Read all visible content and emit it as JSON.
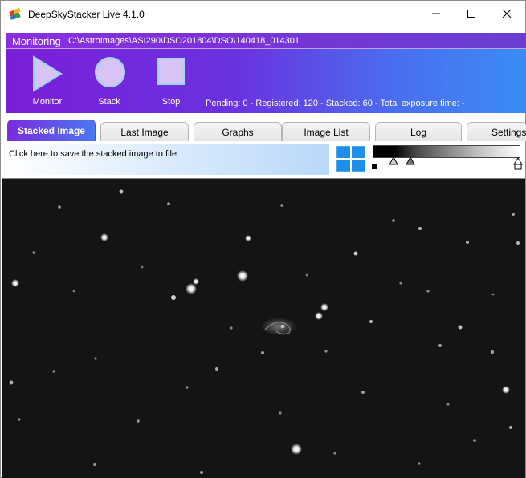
{
  "window": {
    "title": "DeepSkyStacker Live 4.1.0",
    "controls": [
      "minimize-icon",
      "maximize-icon",
      "close-icon"
    ]
  },
  "monitoring": {
    "label": "Monitoring",
    "path": "C:\\AstroImages\\ASI290\\DSO201804\\DSO\\140418_014301",
    "controls": [
      {
        "label": "Monitor",
        "icon": "play-icon"
      },
      {
        "label": "Stack",
        "icon": "circle-icon"
      },
      {
        "label": "Stop",
        "icon": "square-icon"
      }
    ],
    "status": "Pending: 0 - Registered: 120 - Stacked: 60 - Total exposure time: -"
  },
  "tabs": [
    {
      "label": "Stacked Image",
      "active": true
    },
    {
      "label": "Last Image",
      "active": false
    },
    {
      "label": "Graphs",
      "active": false
    },
    {
      "label": "Image List",
      "active": false
    },
    {
      "label": "Log",
      "active": false
    },
    {
      "label": "Settings",
      "active": false
    }
  ],
  "toolbar": {
    "save_hint": "Click here to save the stacked image to file",
    "grid_icon": "four-pane-icon",
    "slider_icon": "gradient-slider"
  },
  "colors": {
    "accent_purple": "#7a1ed8",
    "accent_blue": "#3a8cf5",
    "viewer_bg": "#141416"
  }
}
